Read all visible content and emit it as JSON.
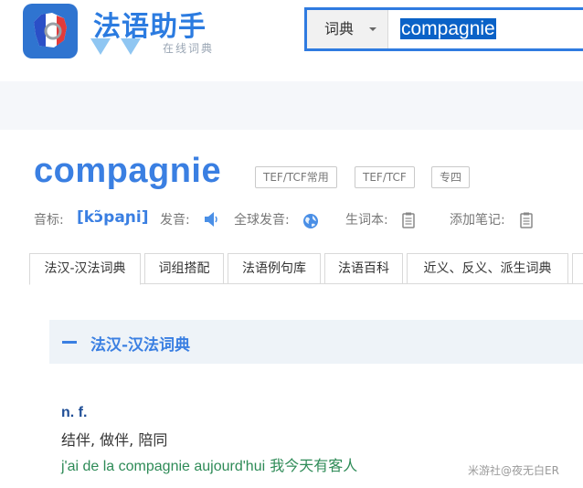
{
  "header": {
    "logo_title": "法语助手",
    "logo_subtitle": "在线词典"
  },
  "search": {
    "mode_label": "词典",
    "query": "compagnie"
  },
  "entry": {
    "word": "compagnie",
    "tags": [
      "TEF/TCF常用",
      "TEF/TCF",
      "专四"
    ],
    "phonetic_label": "音标:",
    "phonetic": "[kɔ̃paɲi]",
    "pronounce_label": "发音:",
    "global_pronounce_label": "全球发音:",
    "wordbook_label": "生词本:",
    "add_note_label": "添加笔记:"
  },
  "tabs": [
    {
      "label": "法汉-汉法词典",
      "active": true
    },
    {
      "label": "词组搭配",
      "active": false
    },
    {
      "label": "法语例句库",
      "active": false
    },
    {
      "label": "法语百科",
      "active": false
    },
    {
      "label": "近义、反义、派生词典",
      "active": false
    }
  ],
  "section": {
    "title": "法汉-汉法词典",
    "pos": "n. f.",
    "definition": "结伴, 做伴, 陪同",
    "example_fr": "j'ai de la compagnie aujourd'hui",
    "example_zh": "我今天有客人"
  },
  "watermark": "米游社@夜无白ER",
  "colors": {
    "brand_blue": "#3a7fe2",
    "search_border": "#2f7be0",
    "example_green": "#2e8b57"
  },
  "icons": {
    "speaker": "speaker-icon",
    "globe": "globe-icon",
    "wordbook": "notebook-icon",
    "note": "note-icon",
    "collapse": "minus-icon"
  }
}
